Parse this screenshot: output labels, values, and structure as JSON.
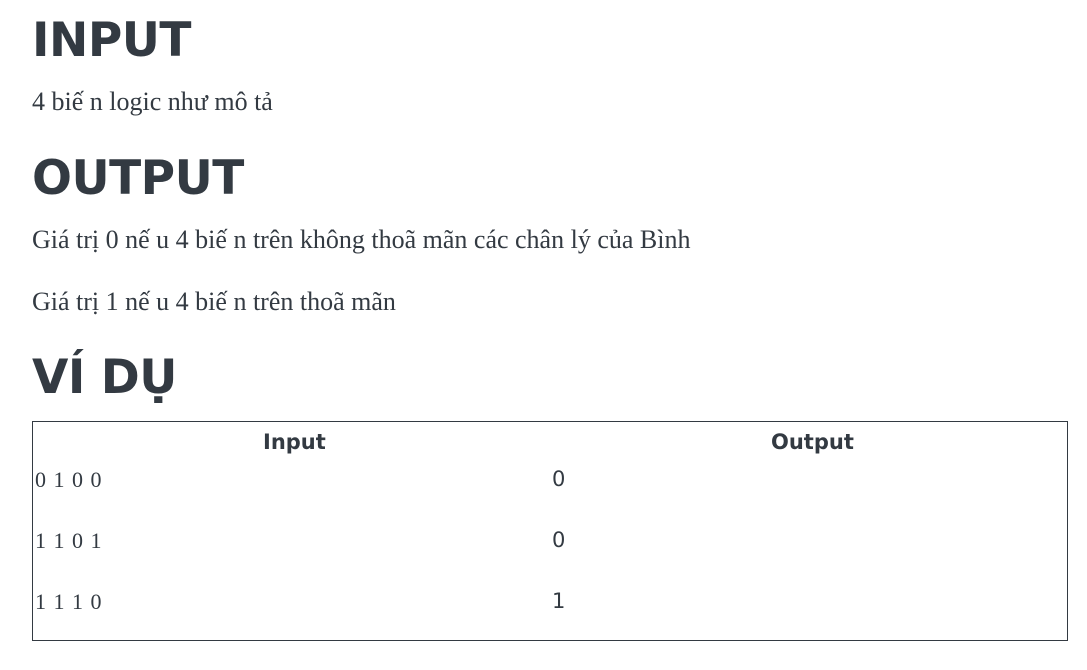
{
  "sections": {
    "input_heading": "INPUT",
    "input_text": "4 biế n logic như mô tả",
    "output_heading": "OUTPUT",
    "output_lines": [
      "Giá trị 0 nế u 4 biế n trên không thoã mãn các chân lý của Bình",
      "Giá trị 1 nế u 4 biế n trên thoã mãn"
    ],
    "example_heading": "VÍ DỤ"
  },
  "example_table": {
    "headers": [
      "Input",
      "Output"
    ],
    "rows": [
      {
        "input": "0 1 0 0",
        "output": "0"
      },
      {
        "input": "1 1 0 1",
        "output": "0"
      },
      {
        "input": "1 1 1 0",
        "output": "1"
      }
    ]
  }
}
